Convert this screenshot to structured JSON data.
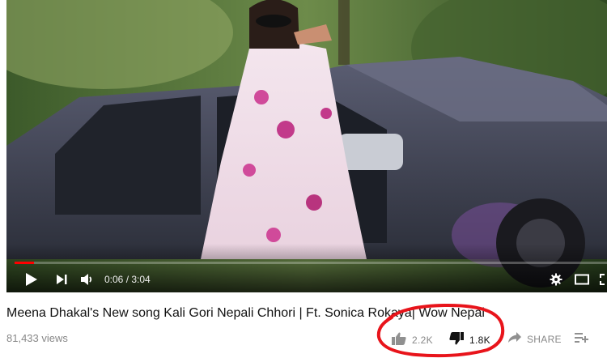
{
  "player": {
    "current_time": "0:06",
    "separator": " / ",
    "duration": "3:04",
    "progress_fraction": 0.033
  },
  "video": {
    "title": "Meena Dhakal's New song Kali Gori Nepali Chhori | Ft. Sonica Rokaya| Wow Nepal",
    "views": "81,433 views",
    "likes": "2.2K",
    "dislikes": "1.8K",
    "share_label": "SHARE"
  },
  "icons": {
    "play": "play-icon",
    "next": "next-icon",
    "volume": "volume-icon",
    "settings": "gear-icon",
    "theater": "theater-icon",
    "like": "thumbs-up-icon",
    "dislike": "thumbs-down-icon",
    "share": "share-arrow-icon",
    "add": "add-to-playlist-icon"
  },
  "colors": {
    "progress": "#ff0000",
    "annotation": "#e8141b",
    "muted_text": "#888888"
  }
}
